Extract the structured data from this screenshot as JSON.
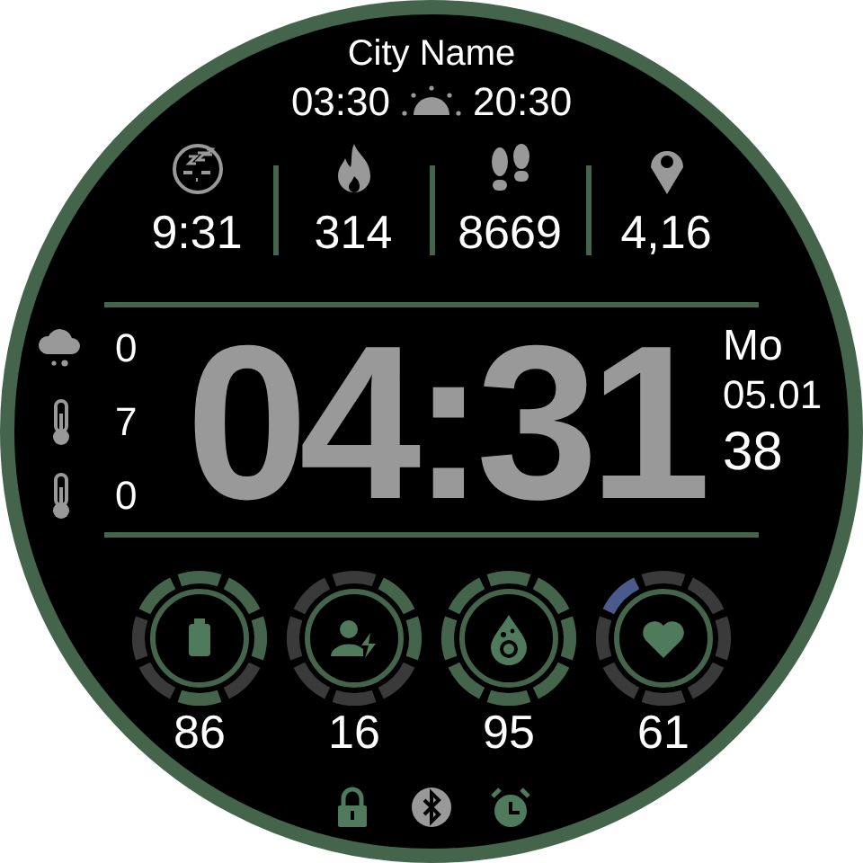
{
  "location": {
    "city": "City Name",
    "sunrise": "03:30",
    "sunset": "20:30"
  },
  "stats": [
    {
      "kind": "sleep",
      "value": "9:31"
    },
    {
      "kind": "calories",
      "value": "314"
    },
    {
      "kind": "steps",
      "value": "8669"
    },
    {
      "kind": "distance",
      "value": "4,16"
    }
  ],
  "weather": [
    {
      "kind": "precipitation",
      "value": "0"
    },
    {
      "kind": "thermometer",
      "value": "7"
    },
    {
      "kind": "thermometer",
      "value": "0"
    }
  ],
  "time": "04:31",
  "date": {
    "weekday": "Mo",
    "day_month": "05.01",
    "week": "38"
  },
  "gauges": [
    {
      "kind": "battery",
      "value": "86"
    },
    {
      "kind": "stress",
      "value": "16"
    },
    {
      "kind": "oxygen",
      "value": "95"
    },
    {
      "kind": "heart",
      "value": "61"
    }
  ],
  "status_icons": [
    {
      "kind": "lock"
    },
    {
      "kind": "bluetooth"
    },
    {
      "kind": "alarm"
    }
  ]
}
